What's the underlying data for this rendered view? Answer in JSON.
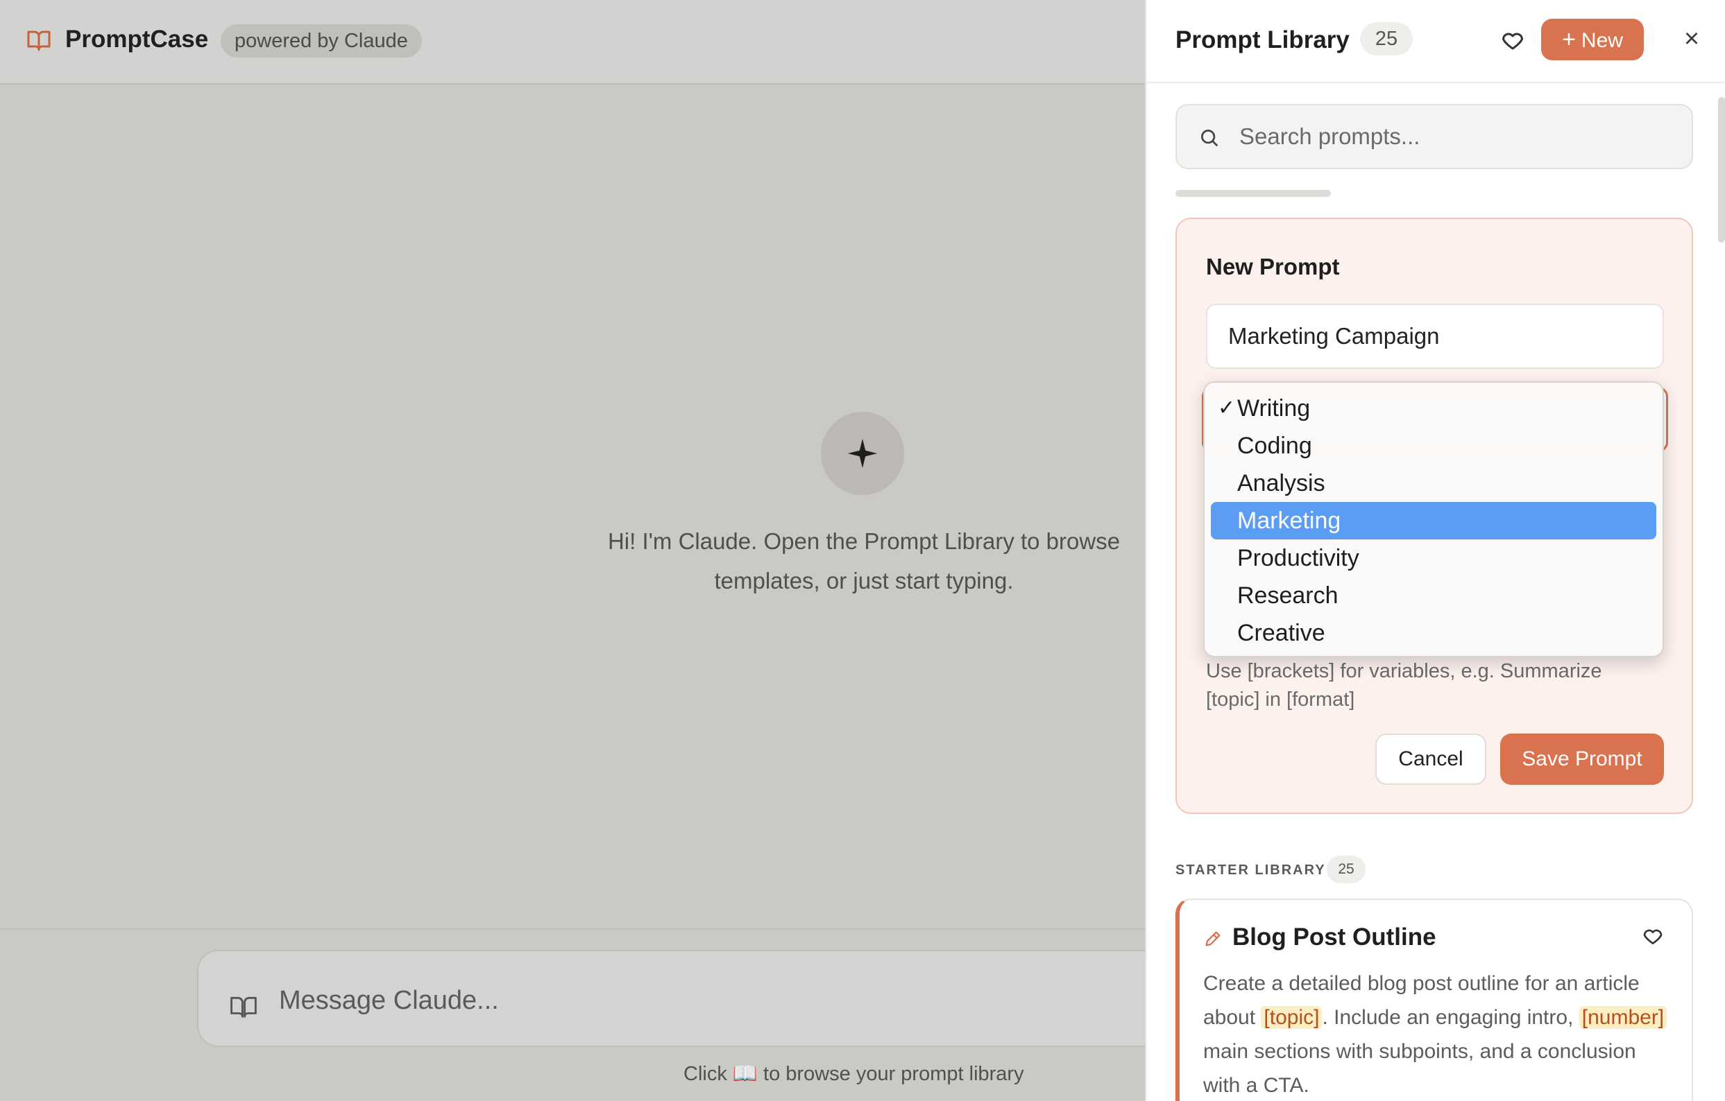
{
  "app": {
    "brand_name": "PromptCase",
    "powered_by": "powered by Claude",
    "welcome_text": "Hi! I'm Claude. Open the Prompt Library to browse templates, or just start typing.",
    "message_placeholder": "Message Claude...",
    "hint_text": "Click 📖 to browse your prompt library"
  },
  "panel": {
    "title": "Prompt Library",
    "count": "25",
    "new_label": "New",
    "close_label": "×",
    "search_placeholder": "Search prompts...",
    "scroll_progress": 0.3
  },
  "new_prompt": {
    "title": "New Prompt",
    "name_value": "Marketing Campaign",
    "help_text": "Use [brackets] for variables, e.g. Summarize [topic] in [format]",
    "cancel_label": "Cancel",
    "save_label": "Save Prompt"
  },
  "category_dropdown": {
    "checked": "Writing",
    "highlighted": "Marketing",
    "options": [
      "Writing",
      "Coding",
      "Analysis",
      "Marketing",
      "Productivity",
      "Research",
      "Creative"
    ]
  },
  "library": {
    "section_label": "STARTER LIBRARY",
    "section_count": "25",
    "cards": [
      {
        "title": "Blog Post Outline",
        "desc_parts": [
          "Create a detailed blog post outline for an article about ",
          "[topic]",
          ". Include an engaging intro, ",
          "[number]",
          " main sections with subpoints, and a conclusion with a CTA."
        ]
      }
    ]
  },
  "colors": {
    "accent": "#d9734f",
    "highlight": "#5b9cf4",
    "variable_bg": "#fbeec2"
  }
}
